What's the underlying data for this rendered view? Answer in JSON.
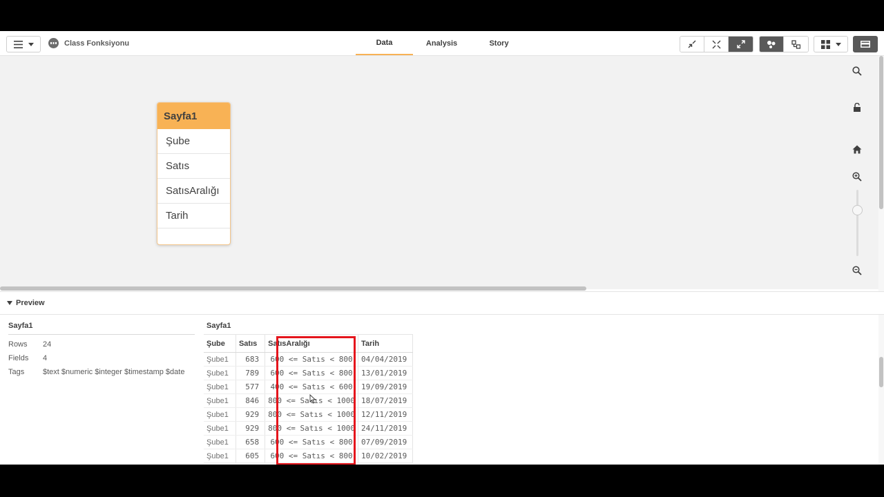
{
  "app": {
    "title": "Class Fonksiyonu",
    "tabs": [
      {
        "label": "Data",
        "active": true
      },
      {
        "label": "Analysis",
        "active": false
      },
      {
        "label": "Story",
        "active": false
      }
    ],
    "accent_color": "#f8b255"
  },
  "canvas": {
    "table": {
      "name": "Sayfa1",
      "fields": [
        "Şube",
        "Satıs",
        "SatısAralığı",
        "Tarih"
      ]
    }
  },
  "preview": {
    "label": "Preview",
    "meta": {
      "title": "Sayfa1",
      "rows_label": "Rows",
      "rows_value": "24",
      "fields_label": "Fields",
      "fields_value": "4",
      "tags_label": "Tags",
      "tags_value": "$text $numeric $integer $timestamp $date"
    },
    "table_title": "Sayfa1",
    "columns": [
      "Şube",
      "Satıs",
      "SatısAralığı",
      "Tarih"
    ],
    "rows": [
      [
        "Şube1",
        "683",
        "600 <= Satıs < 800",
        "04/04/2019"
      ],
      [
        "Şube1",
        "789",
        "600 <= Satıs < 800",
        "13/01/2019"
      ],
      [
        "Şube1",
        "577",
        "400 <= Satıs < 600",
        "19/09/2019"
      ],
      [
        "Şube1",
        "846",
        "800 <= Satıs < 1000",
        "18/07/2019"
      ],
      [
        "Şube1",
        "929",
        "800 <= Satıs < 1000",
        "12/11/2019"
      ],
      [
        "Şube1",
        "929",
        "800 <= Satıs < 1000",
        "24/11/2019"
      ],
      [
        "Şube1",
        "658",
        "600 <= Satıs < 800",
        "07/09/2019"
      ],
      [
        "Şube1",
        "605",
        "600 <= Satıs < 800",
        "10/02/2019"
      ]
    ]
  }
}
